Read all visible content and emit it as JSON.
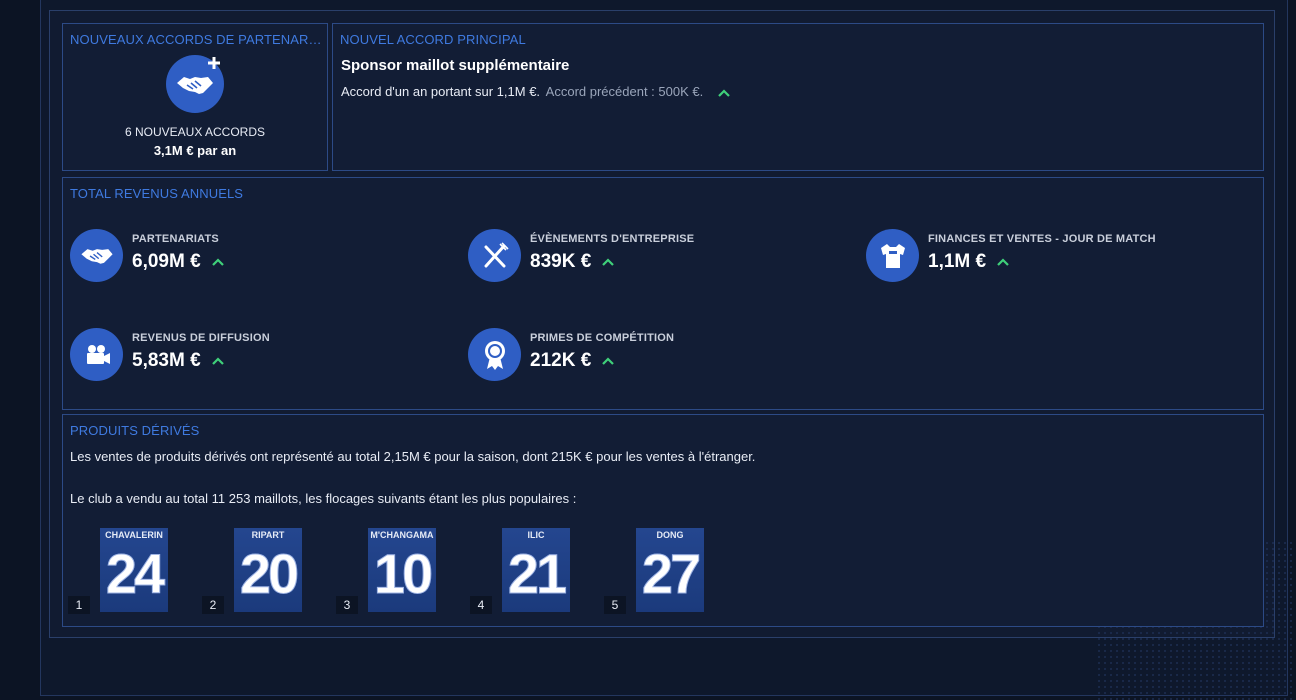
{
  "new_deals": {
    "title": "NOUVEAUX ACCORDS DE PARTENARI...",
    "count_label": "6 NOUVEAUX ACCORDS",
    "amount": "3,1M € par an",
    "icon": "handshake-plus-icon"
  },
  "main_deal": {
    "title": "NOUVEL ACCORD PRINCIPAL",
    "headline": "Sponsor maillot supplémentaire",
    "description": "Accord d'un an portant sur 1,1M €.",
    "previous": "Accord précédent : 500K €."
  },
  "annual_revenue": {
    "title": "TOTAL REVENUS ANNUELS",
    "items": [
      {
        "label": "PARTENARIATS",
        "value": "6,09M €",
        "icon": "handshake-icon"
      },
      {
        "label": "ÉVÈNEMENTS D'ENTREPRISE",
        "value": "839K €",
        "icon": "cutlery-icon"
      },
      {
        "label": "FINANCES ET VENTES - JOUR DE MATCH",
        "value": "1,1M €",
        "icon": "shirt-icon"
      },
      {
        "label": "REVENUS DE DIFFUSION",
        "value": "5,83M €",
        "icon": "camera-icon"
      },
      {
        "label": "PRIMES DE COMPÉTITION",
        "value": "212K €",
        "icon": "ribbon-icon"
      }
    ]
  },
  "merch": {
    "title": "PRODUITS DÉRIVÉS",
    "line1": "Les ventes de produits dérivés ont représenté au total 2,15M € pour la saison, dont 215K € pour les ventes à l'étranger.",
    "line2": "Le club a vendu au total 11 253 maillots, les flocages suivants étant les plus populaires :",
    "shirts": [
      {
        "rank": "1",
        "name": "CHAVALERIN",
        "number": "24"
      },
      {
        "rank": "2",
        "name": "RIPART",
        "number": "20"
      },
      {
        "rank": "3",
        "name": "M'CHANGAMA",
        "number": "10"
      },
      {
        "rank": "4",
        "name": "ILIC",
        "number": "21"
      },
      {
        "rank": "5",
        "name": "DONG",
        "number": "27"
      }
    ]
  },
  "colors": {
    "accent": "#3f7ae0",
    "icon_bg": "#2f5ec4",
    "up": "#3fd07a"
  }
}
